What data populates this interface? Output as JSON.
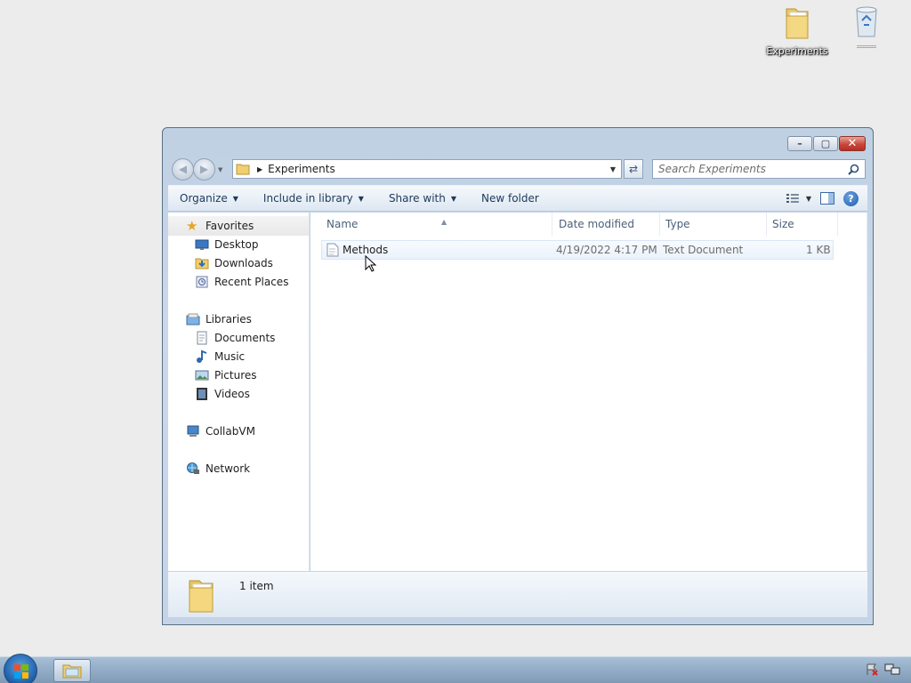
{
  "desktop": {
    "icons": [
      {
        "label": "Experiments",
        "icon": "folder-icon"
      },
      {
        "label": "",
        "icon": "recycle-bin-icon"
      }
    ]
  },
  "window": {
    "controls": {
      "minimize": "minimize-icon",
      "maximize": "maximize-icon",
      "close": "close-icon"
    },
    "address": {
      "crumbs": [
        "Experiments"
      ]
    },
    "search": {
      "placeholder": "Search Experiments"
    },
    "command_bar": {
      "organize": "Organize",
      "include": "Include in library",
      "share": "Share with",
      "new_folder": "New folder"
    },
    "nav": {
      "favorites": {
        "label": "Favorites",
        "items": [
          "Desktop",
          "Downloads",
          "Recent Places"
        ]
      },
      "libraries": {
        "label": "Libraries",
        "items": [
          "Documents",
          "Music",
          "Pictures",
          "Videos"
        ]
      },
      "computer": "CollabVM",
      "network": "Network"
    },
    "columns": {
      "name": "Name",
      "date": "Date modified",
      "type": "Type",
      "size": "Size"
    },
    "files": [
      {
        "name": "Methods",
        "date": "4/19/2022 4:17 PM",
        "type": "Text Document",
        "size": "1 KB"
      }
    ],
    "details": {
      "count": "1 item"
    }
  },
  "colors": {
    "accent": "#1e395b",
    "selection": "#eaf2fb",
    "window_frame": "#c4d4e6"
  }
}
